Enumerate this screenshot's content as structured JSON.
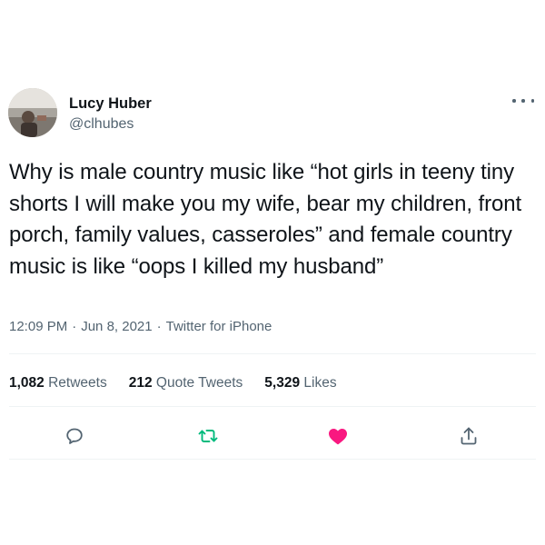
{
  "author": {
    "name": "Lucy Huber",
    "handle": "@clhubes"
  },
  "tweet": {
    "text": "Why is male country music like “hot girls in teeny tiny shorts I will make you my wife, bear my children, front porch, family values, casseroles” and female country music is like “oops I killed my husband”",
    "time": "12:09 PM",
    "date": "Jun 8, 2021",
    "source": "Twitter for iPhone",
    "separator": "·"
  },
  "stats": {
    "retweets": {
      "count": "1,082",
      "label": "Retweets"
    },
    "quote_tweets": {
      "count": "212",
      "label": "Quote Tweets"
    },
    "likes": {
      "count": "5,329",
      "label": "Likes"
    }
  },
  "actions": {
    "reply_icon": "reply-bubble-icon",
    "retweet_icon": "retweet-arrows-icon",
    "like_icon": "heart-filled-icon",
    "share_icon": "share-upload-icon"
  },
  "colors": {
    "text": "#0f1419",
    "secondary": "#536471",
    "divider": "#eff3f4",
    "retweet_green": "#00ba7c",
    "like_pink": "#f91880"
  }
}
